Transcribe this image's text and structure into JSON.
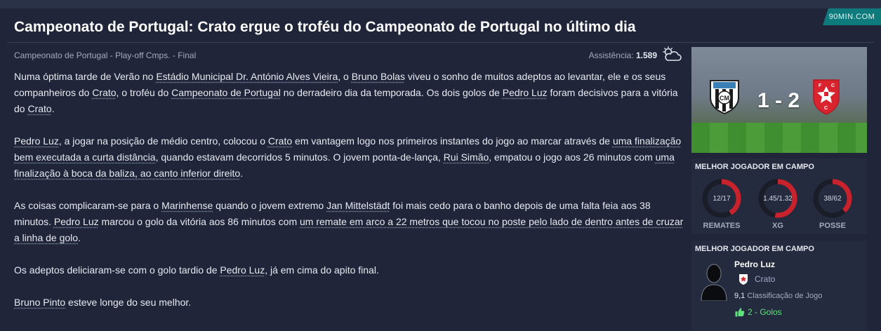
{
  "brand": "90MIN.COM",
  "headline": "Campeonato de Portugal: Crato ergue o troféu do Campeonato de Portugal no último dia",
  "subtitle": "Campeonato de Portugal - Play-off Cmps. - Final",
  "attendance": {
    "label": "Assistência:",
    "value": "1.589",
    "weather_icon": "partly-cloudy-icon"
  },
  "article": {
    "p1": [
      {
        "t": "Numa óptima tarde de Verão no "
      },
      {
        "t": "Estádio Municipal Dr. António Alves Vieira",
        "link": true
      },
      {
        "t": ", o "
      },
      {
        "t": "Bruno Bolas",
        "link": true
      },
      {
        "t": " viveu o sonho de muitos adeptos ao levantar, ele e os seus companheiros do "
      },
      {
        "t": "Crato",
        "link": true
      },
      {
        "t": ", o troféu do "
      },
      {
        "t": "Campeonato de Portugal",
        "link": true
      },
      {
        "t": " no derradeiro dia da temporada. Os dois golos de "
      },
      {
        "t": "Pedro Luz",
        "link": true
      },
      {
        "t": " foram decisivos para a vitória do "
      },
      {
        "t": "Crato",
        "link": true
      },
      {
        "t": "."
      }
    ],
    "p2": [
      {
        "t": "Pedro Luz",
        "link": true
      },
      {
        "t": ", a jogar na posição de médio centro, colocou o "
      },
      {
        "t": "Crato",
        "link": true
      },
      {
        "t": " em vantagem logo nos primeiros instantes do jogo ao marcar através de "
      },
      {
        "t": "uma finalização bem executada a curta distância",
        "link": true
      },
      {
        "t": ", quando estavam decorridos 5 minutos. O jovem ponta-de-lança, "
      },
      {
        "t": "Rui Simão",
        "link": true
      },
      {
        "t": ", empatou o jogo aos 26 minutos com "
      },
      {
        "t": "uma finalização à boca da baliza, ao canto inferior direito",
        "link": true
      },
      {
        "t": "."
      }
    ],
    "p3": [
      {
        "t": "As coisas complicaram-se para o "
      },
      {
        "t": "Marinhense",
        "link": true
      },
      {
        "t": " quando o jovem extremo "
      },
      {
        "t": "Jan Mittelstädt",
        "link": true
      },
      {
        "t": " foi mais cedo para o banho depois de uma falta feia aos 38 minutos. "
      },
      {
        "t": "Pedro Luz",
        "link": true
      },
      {
        "t": " marcou o golo da vitória aos 86 minutos com "
      },
      {
        "t": "um remate em arco a 22 metros que tocou no poste pelo lado de dentro antes de cruzar a linha de golo",
        "link": true
      },
      {
        "t": "."
      }
    ],
    "p4": [
      {
        "t": "Os adeptos deliciaram-se com o golo tardio de "
      },
      {
        "t": "Pedro Luz",
        "link": true
      },
      {
        "t": ", já em cima do apito final."
      }
    ],
    "p5": [
      {
        "t": "Bruno Pinto",
        "link": true
      },
      {
        "t": " esteve longe do seu melhor."
      }
    ]
  },
  "match": {
    "score": "1 - 2",
    "home_crest": "marinhense-crest-icon",
    "away_crest": "crato-crest-icon"
  },
  "stats": {
    "title": "MELHOR JOGADOR EM CAMPO",
    "items": [
      {
        "label": "REMATES",
        "value": "12/17",
        "fraction": 0.4138
      },
      {
        "label": "XG",
        "value": "1.45/1.32",
        "fraction": 0.5235
      },
      {
        "label": "POSSE",
        "value": "38/62",
        "fraction": 0.38
      }
    ],
    "ring_color": "#c8232c",
    "ring_track": "#1a1d27"
  },
  "potm": {
    "title": "MELHOR JOGADOR EM CAMPO",
    "name": "Pedro Luz",
    "club": "Crato",
    "rating_value": "9,1",
    "rating_label": "Classificação de Jogo",
    "goals": "2 - Golos",
    "goals_color": "#5fe07d"
  }
}
